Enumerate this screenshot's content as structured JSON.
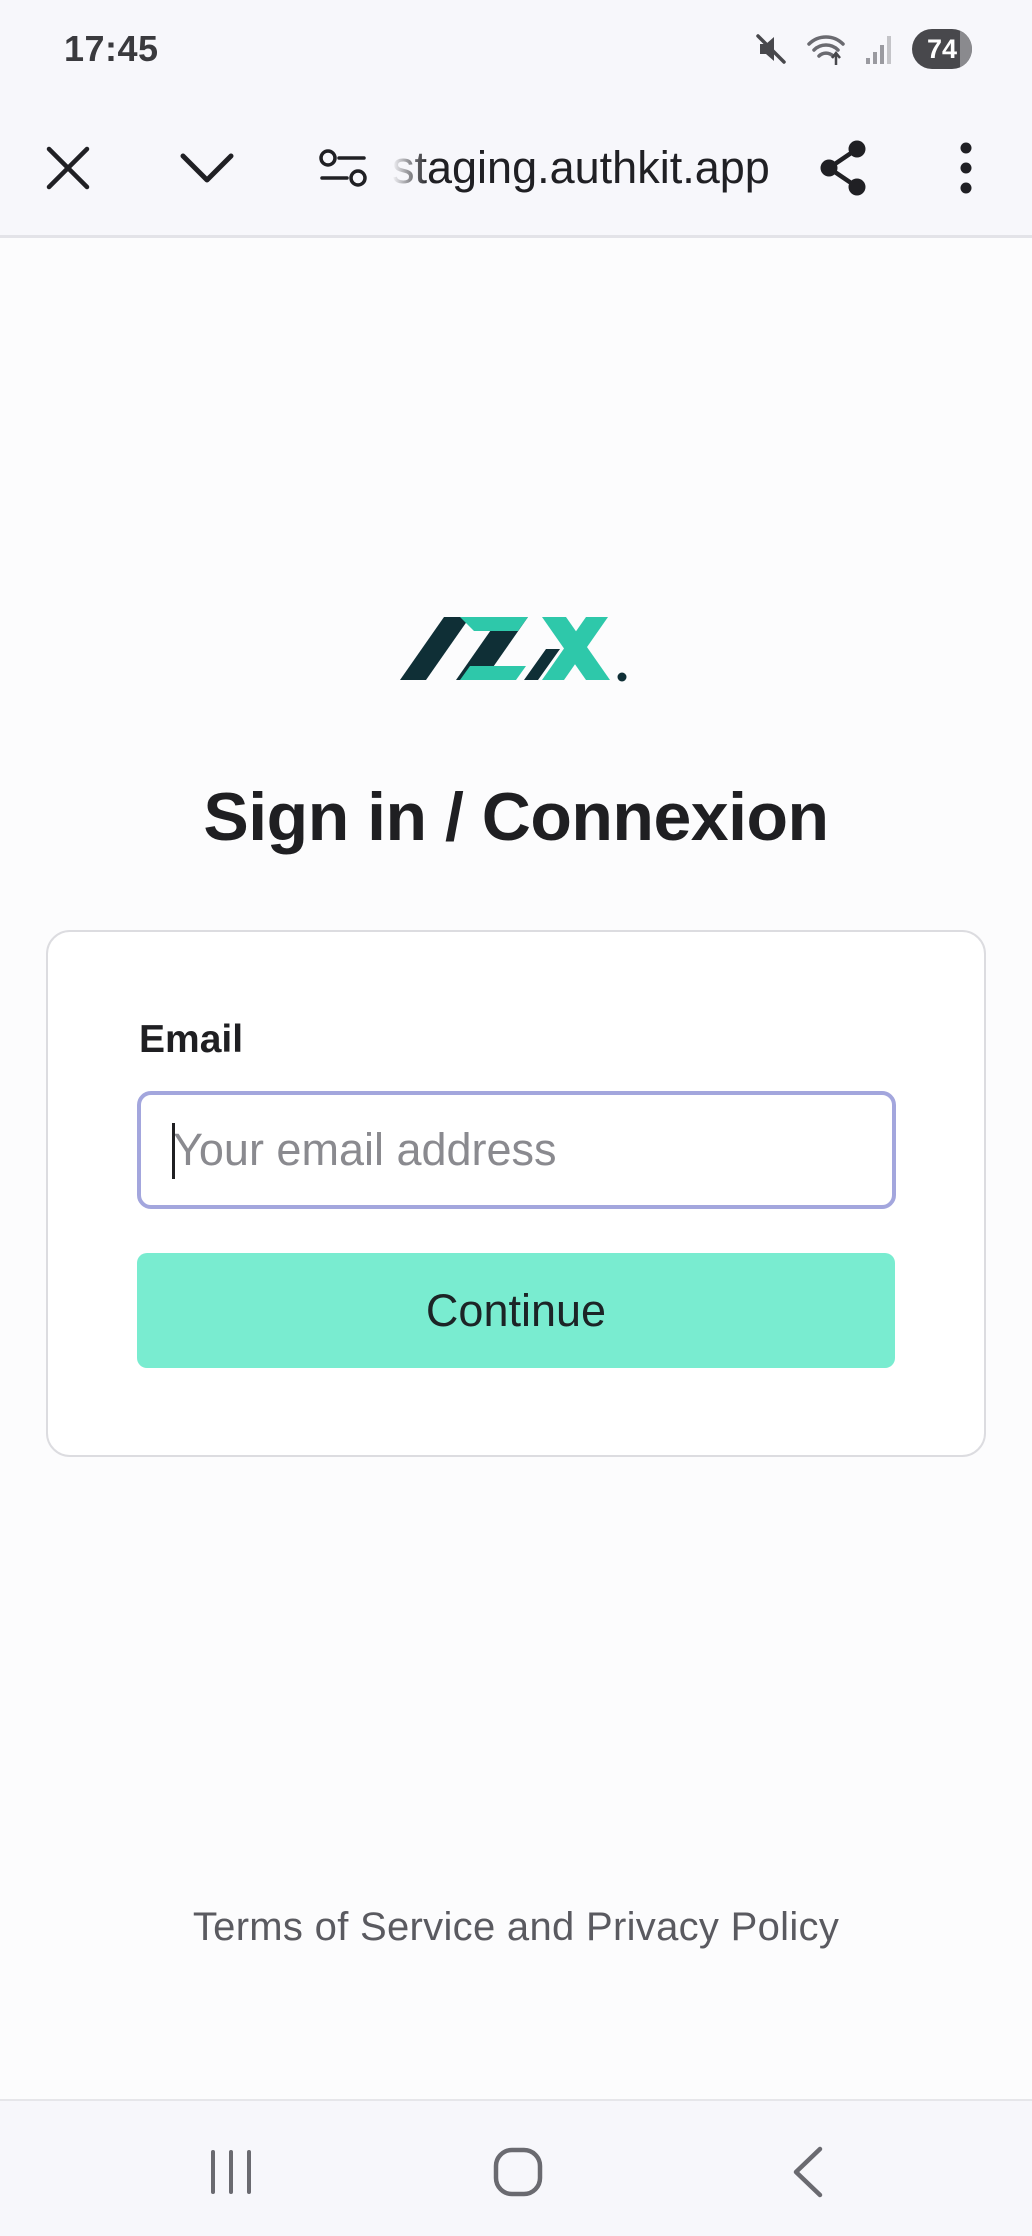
{
  "status_bar": {
    "time": "17:45",
    "battery": "74",
    "icons": [
      "mute-icon",
      "wifi-icon",
      "signal-icon",
      "battery-icon"
    ]
  },
  "browser": {
    "url": "staging.authkit.app",
    "icons": [
      "close-icon",
      "chevron-down-icon",
      "site-settings-icon",
      "share-icon",
      "more-vert-icon"
    ]
  },
  "page": {
    "title": "Sign in / Connexion",
    "email_label": "Email",
    "email_placeholder": "Your email address",
    "email_value": "",
    "continue_label": "Continue",
    "footer": {
      "terms": "Terms of Service",
      "and": "and",
      "privacy": "Privacy Policy"
    }
  },
  "colors": {
    "accent": "#79ecd0",
    "logo_dark": "#0f2f36",
    "logo_teal": "#2ec8aa",
    "input_focus_border": "#a3a6dd"
  },
  "nav_bar": {
    "icons": [
      "recents-icon",
      "home-icon",
      "back-icon"
    ]
  }
}
